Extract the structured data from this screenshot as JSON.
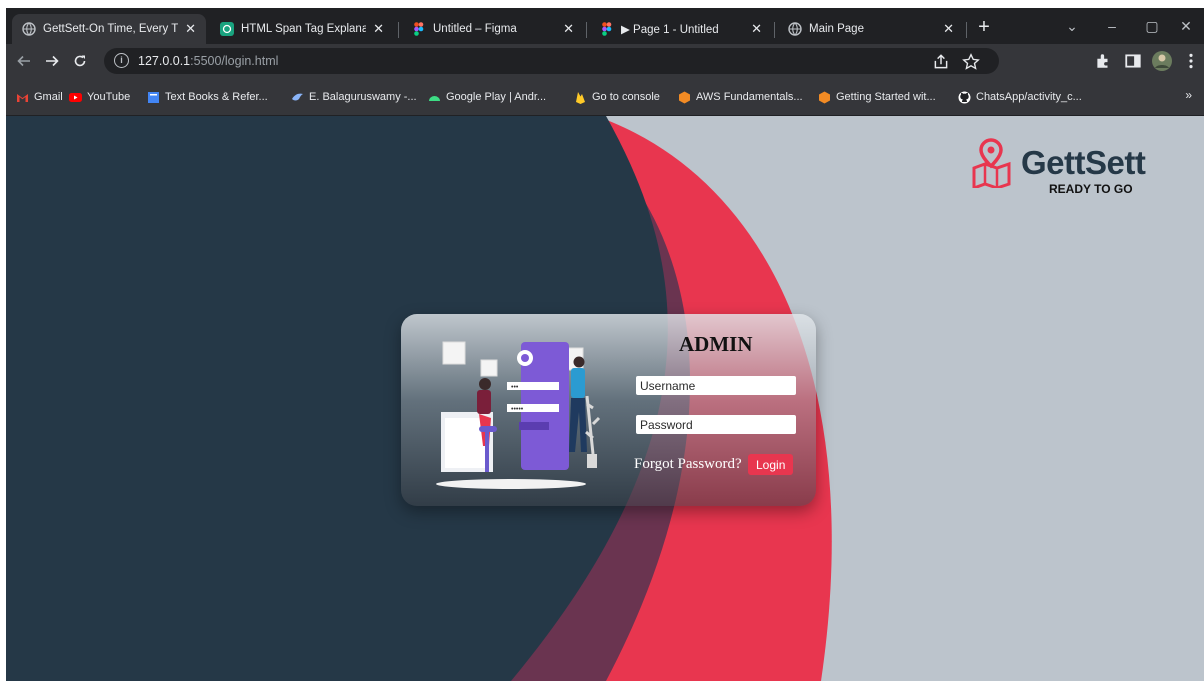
{
  "tabs": [
    {
      "title": "GettSett-On Time, Every T",
      "icon": "globe-icon",
      "active": true
    },
    {
      "title": "HTML Span Tag Explanati",
      "icon": "chatgpt-icon",
      "active": false
    },
    {
      "title": "Untitled – Figma",
      "icon": "figma-icon",
      "active": false
    },
    {
      "title": "▶ Page 1 - Untitled",
      "icon": "figma-icon",
      "active": false
    },
    {
      "title": "Main Page",
      "icon": "globe-icon",
      "active": false
    }
  ],
  "tab_close_glyph": "✕",
  "new_tab_glyph": "+",
  "window_controls": {
    "menu": "⌄",
    "minimize": "–",
    "restore": "▢",
    "close": "✕"
  },
  "address": {
    "host": "127.0.0.1",
    "path": ":5500/login.html",
    "info_glyph": "i"
  },
  "bookmarks": [
    {
      "label": "Gmail",
      "icon": "gmail-icon",
      "color": "#ea4335"
    },
    {
      "label": "YouTube",
      "icon": "youtube-icon",
      "color": "#ff0000"
    },
    {
      "label": "Text Books & Refer...",
      "icon": "book-icon",
      "color": "#4285f4"
    },
    {
      "label": "E. Balaguruswamy -...",
      "icon": "bird-icon",
      "color": "#8ab4f8"
    },
    {
      "label": "Google Play | Andr...",
      "icon": "android-icon",
      "color": "#3ddc84"
    },
    {
      "label": "Go to console",
      "icon": "firebase-icon",
      "color": "#ffca28"
    },
    {
      "label": "AWS Fundamentals...",
      "icon": "aws-icon",
      "color": "#f28b24"
    },
    {
      "label": "Getting Started wit...",
      "icon": "aws-icon",
      "color": "#f28b24"
    },
    {
      "label": "ChatsApp/activity_c...",
      "icon": "github-icon",
      "color": "#ffffff"
    }
  ],
  "bookmarks_more": "»",
  "logo": {
    "name": "GettSett",
    "tagline": "READY TO GO",
    "icon": "map-pin-icon",
    "color": "#e8364f"
  },
  "login": {
    "title": "ADMIN",
    "username_placeholder": "Username",
    "password_placeholder": "Password",
    "forgot_label": "Forgot Password?",
    "login_label": "Login"
  },
  "colors": {
    "accent": "#e8364f",
    "dark_bg": "#253847",
    "page_bg": "#bcc4cc"
  }
}
